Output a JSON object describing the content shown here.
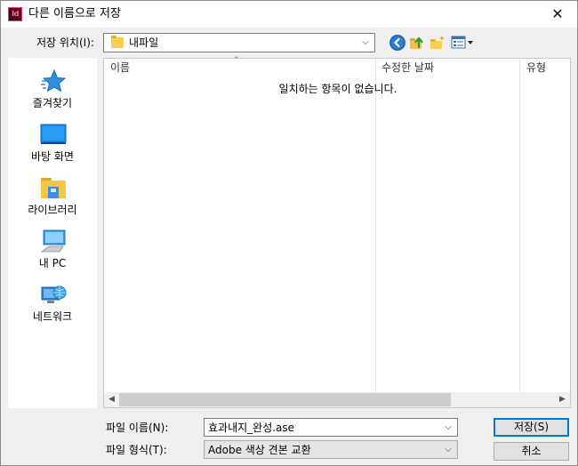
{
  "window": {
    "title": "다른 이름으로 저장",
    "app_icon_text": "Id",
    "close_symbol": "✕"
  },
  "location": {
    "label": "저장 위치(I):",
    "current": "내파일"
  },
  "toolbar": {
    "icons": [
      "back-icon",
      "up-folder-icon",
      "new-folder-icon",
      "view-menu-icon"
    ]
  },
  "places": [
    {
      "label": "즐겨찾기",
      "icon": "star-icon"
    },
    {
      "label": "바탕 화면",
      "icon": "desktop-icon"
    },
    {
      "label": "라이브러리",
      "icon": "library-folder-icon"
    },
    {
      "label": "내 PC",
      "icon": "computer-icon"
    },
    {
      "label": "네트워크",
      "icon": "network-icon"
    }
  ],
  "filelist": {
    "columns": [
      "이름",
      "수정한 날짜",
      "유형"
    ],
    "empty_message": "일치하는 항목이 없습니다."
  },
  "fields": {
    "filename_label": "파일 이름(N):",
    "filename_value": "효과내지_완성.ase",
    "filetype_label": "파일 형식(T):",
    "filetype_value": "Adobe 색상 견본 교환"
  },
  "buttons": {
    "save": "저장(S)",
    "cancel": "취소"
  },
  "colors": {
    "accent": "#0078d7",
    "folder": "#f7cf55",
    "indesign_bg": "#49021f",
    "indesign_fg": "#ff3366"
  }
}
